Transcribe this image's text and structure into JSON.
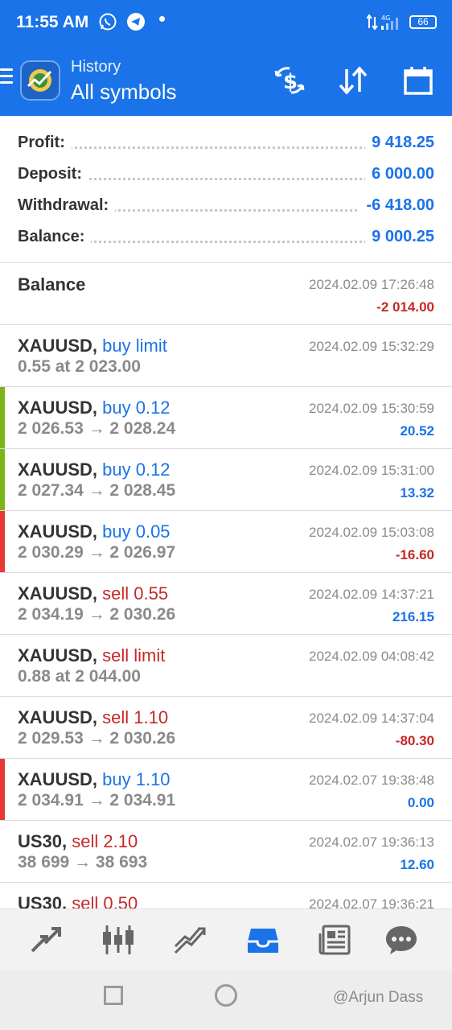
{
  "status_bar": {
    "time": "11:55 AM",
    "network": "4G",
    "battery": "66"
  },
  "app_bar": {
    "subtitle": "History",
    "title": "All symbols"
  },
  "summary": [
    {
      "label": "Profit:",
      "value": "9 418.25"
    },
    {
      "label": "Deposit:",
      "value": "6 000.00"
    },
    {
      "label": "Withdrawal:",
      "value": "-6 418.00"
    },
    {
      "label": "Balance:",
      "value": "9 000.25"
    }
  ],
  "rows": [
    {
      "symbol": "Balance",
      "op": "",
      "op_color": "#1a73e8",
      "detail": "",
      "datetime": "2024.02.09 17:26:48",
      "pnl": "-2 014.00",
      "pnl_color": "#c62828",
      "bar": ""
    },
    {
      "symbol": "XAUUSD,",
      "op": "buy limit",
      "op_color": "#1a73e8",
      "detail": "0.55 at 2 023.00",
      "datetime": "2024.02.09 15:32:29",
      "pnl": "",
      "pnl_color": "#1a73e8",
      "bar": ""
    },
    {
      "symbol": "XAUUSD,",
      "op": "buy 0.12",
      "op_color": "#1a73e8",
      "detail": "2 026.53 → 2 028.24",
      "datetime": "2024.02.09 15:30:59",
      "pnl": "20.52",
      "pnl_color": "#1a73e8",
      "bar": "#7cb518"
    },
    {
      "symbol": "XAUUSD,",
      "op": "buy 0.12",
      "op_color": "#1a73e8",
      "detail": "2 027.34 → 2 028.45",
      "datetime": "2024.02.09 15:31:00",
      "pnl": "13.32",
      "pnl_color": "#1a73e8",
      "bar": "#7cb518"
    },
    {
      "symbol": "XAUUSD,",
      "op": "buy 0.05",
      "op_color": "#1a73e8",
      "detail": "2 030.29 → 2 026.97",
      "datetime": "2024.02.09 15:03:08",
      "pnl": "-16.60",
      "pnl_color": "#c62828",
      "bar": "#e53935"
    },
    {
      "symbol": "XAUUSD,",
      "op": "sell 0.55",
      "op_color": "#c62828",
      "detail": "2 034.19 → 2 030.26",
      "datetime": "2024.02.09 14:37:21",
      "pnl": "216.15",
      "pnl_color": "#1a73e8",
      "bar": ""
    },
    {
      "symbol": "XAUUSD,",
      "op": "sell limit",
      "op_color": "#c62828",
      "detail": "0.88 at 2 044.00",
      "datetime": "2024.02.09 04:08:42",
      "pnl": "",
      "pnl_color": "#1a73e8",
      "bar": ""
    },
    {
      "symbol": "XAUUSD,",
      "op": "sell 1.10",
      "op_color": "#c62828",
      "detail": "2 029.53 → 2 030.26",
      "datetime": "2024.02.09 14:37:04",
      "pnl": "-80.30",
      "pnl_color": "#c62828",
      "bar": ""
    },
    {
      "symbol": "XAUUSD,",
      "op": "buy 1.10",
      "op_color": "#1a73e8",
      "detail": "2 034.91 → 2 034.91",
      "datetime": "2024.02.07 19:38:48",
      "pnl": "0.00",
      "pnl_color": "#1a73e8",
      "bar": "#e53935"
    },
    {
      "symbol": "US30,",
      "op": "sell 2.10",
      "op_color": "#c62828",
      "detail": "38 699 → 38 693",
      "datetime": "2024.02.07 19:36:13",
      "pnl": "12.60",
      "pnl_color": "#1a73e8",
      "bar": ""
    },
    {
      "symbol": "US30,",
      "op": "sell 0.50",
      "op_color": "#c62828",
      "detail": "",
      "datetime": "2024.02.07 19:36:21",
      "pnl": "",
      "pnl_color": "#1a73e8",
      "bar": ""
    }
  ],
  "bottom_nav": [
    {
      "icon": "quotes-icon",
      "active": false
    },
    {
      "icon": "chart-icon",
      "active": false
    },
    {
      "icon": "trade-icon",
      "active": false
    },
    {
      "icon": "history-icon",
      "active": true
    },
    {
      "icon": "news-icon",
      "active": false
    },
    {
      "icon": "chat-icon",
      "active": false
    }
  ],
  "watermark": "@Arjun Dass"
}
